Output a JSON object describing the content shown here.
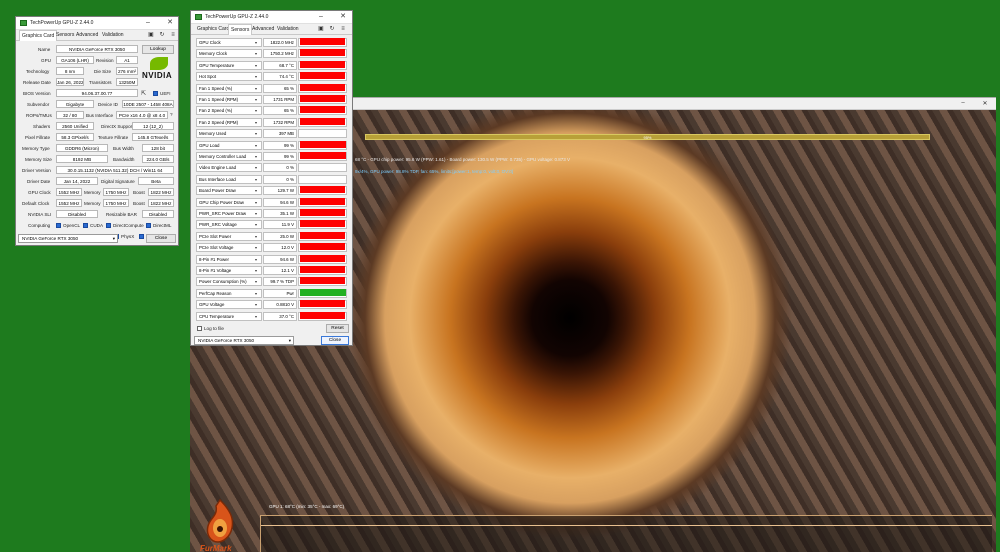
{
  "furmark": {
    "progress_label": "95%",
    "info_line1": "68 °C - GPU chip power: 95.6 W (PPW: 1.61) - Board power: 130.5 W (PPW: 0.735) - GPU voltage: 0.873 V",
    "info_line2": "9x/4%, GPU power: 98.8% TDP, fan: 65%, limits:[power:1, temp:0, volt:0, OV:0]",
    "graph_label": "GPU 1: 68°C (min: 35°C - max: 69°C)",
    "logo_text": "FurMark"
  },
  "gpuz_card": {
    "title": "TechPowerUp GPU-Z 2.44.0",
    "tabs": [
      "Graphics Card",
      "Sensors",
      "Advanced",
      "Validation"
    ],
    "lookup_label": "Lookup",
    "uefi_label": "UEFI",
    "nvidia_logo_text": "NVIDIA",
    "fields": {
      "name_label": "Name",
      "name": "NVIDIA GeForce RTX 3050",
      "gpu_label": "GPU",
      "gpu": "GA106 (LHR)",
      "revision_label": "Revision",
      "revision": "A1",
      "technology_label": "Technology",
      "technology": "8 nm",
      "die_size_label": "Die Size",
      "die_size": "276 mm²",
      "release_date_label": "Release Date",
      "release_date": "Jan 26, 2022",
      "transistors_label": "Transistors",
      "transistors": "13250M",
      "bios_label": "BIOS Version",
      "bios": "94.06.37.00.77",
      "subvendor_label": "Subvendor",
      "subvendor": "Gigabyte",
      "device_id_label": "Device ID",
      "device_id": "10DE 2507 - 1458 408A",
      "rops_label": "ROPs/TMUs",
      "rops": "32 / 80",
      "bus_label": "Bus Interface",
      "bus": "PCIe x16 4.0 @ x8 4.0",
      "shaders_label": "Shaders",
      "shaders": "2560 Unified",
      "dx_label": "DirectX Support",
      "dx": "12 (12_2)",
      "pixel_label": "Pixel Fillrate",
      "pixel": "58.3 GPixel/s",
      "texture_label": "Texture Fillrate",
      "texture": "145.8 GTexel/s",
      "memtype_label": "Memory Type",
      "memtype": "GDDR6 (Micron)",
      "buswidth_label": "Bus Width",
      "buswidth": "128 bit",
      "memsize_label": "Memory Size",
      "memsize": "8192 MB",
      "bandwidth_label": "Bandwidth",
      "bandwidth": "224.0 GB/s",
      "driver_label": "Driver Version",
      "driver": "30.0.15.1132 (NVIDIA 511.32) DCH / Win11 64",
      "driver_date_label": "Driver Date",
      "driver_date": "Jan 14, 2022",
      "sig_label": "Digital Signature",
      "sig": "Beta",
      "gpuclock_label": "GPU Clock",
      "gpuclock": "1552 MHz",
      "memory_label": "Memory",
      "memory": "1750 MHz",
      "boost_label": "Boost",
      "boost": "1822 MHz",
      "defclock_label": "Default Clock",
      "defclock": "1552 MHz",
      "defmemory": "1750 MHz",
      "defboost": "1822 MHz",
      "sli_label": "NVIDIA SLI",
      "sli": "Disabled",
      "bar_label": "Resizable BAR",
      "bar": "Disabled",
      "computing_label": "Computing",
      "technologies_label": "Technologies"
    },
    "computing": [
      "OpenCL",
      "CUDA",
      "DirectCompute",
      "DirectML"
    ],
    "technologies": [
      "Vulkan",
      "Ray Tracing",
      "PhysX",
      "OpenGL 4.6"
    ],
    "gpu_select": "NVIDIA GeForce RTX 3050",
    "close_label": "Close"
  },
  "gpuz_sensors": {
    "title": "TechPowerUp GPU-Z 2.44.0",
    "tabs": [
      "Graphics Card",
      "Sensors",
      "Advanced",
      "Validation"
    ],
    "log_label": "Log to file",
    "reset_label": "Reset",
    "gpu_select": "NVIDIA GeForce RTX 3050",
    "close_label": "Close",
    "bar_color": "#ff0000",
    "perfcap_color": "#22b022",
    "sensors": [
      {
        "name": "GPU Clock",
        "value": "1822.0 MHz",
        "fill": 0.95
      },
      {
        "name": "Memory Clock",
        "value": "1750.2 MHz",
        "fill": 0.95
      },
      {
        "name": "GPU Temperature",
        "value": "68.7 °C",
        "fill": 0.95
      },
      {
        "name": "Hot Spot",
        "value": "74.4 °C",
        "fill": 0.95
      },
      {
        "name": "Fan 1 Speed (%)",
        "value": "65 %",
        "fill": 0.95
      },
      {
        "name": "Fan 1 Speed (RPM)",
        "value": "1731 RPM",
        "fill": 0.95
      },
      {
        "name": "Fan 2 Speed (%)",
        "value": "65 %",
        "fill": 0.95
      },
      {
        "name": "Fan 2 Speed (RPM)",
        "value": "1732 RPM",
        "fill": 0.95
      },
      {
        "name": "Memory Used",
        "value": "397 MB",
        "fill": 0
      },
      {
        "name": "GPU Load",
        "value": "99 %",
        "fill": 0.98
      },
      {
        "name": "Memory Controller Load",
        "value": "99 %",
        "fill": 0.98
      },
      {
        "name": "Video Engine Load",
        "value": "0 %",
        "fill": 0
      },
      {
        "name": "Bus Interface Load",
        "value": "0 %",
        "fill": 0
      },
      {
        "name": "Board Power Draw",
        "value": "129.7 W",
        "fill": 0.95
      },
      {
        "name": "GPU Chip Power Draw",
        "value": "94.6 W",
        "fill": 0.95
      },
      {
        "name": "PWR_SRC Power Draw",
        "value": "35.1 W",
        "fill": 0.95
      },
      {
        "name": "PWR_SRC Voltage",
        "value": "11.9 V",
        "fill": 0.95
      },
      {
        "name": "PCIe Slot Power",
        "value": "25.0 W",
        "fill": 0.95
      },
      {
        "name": "PCIe Slot Voltage",
        "value": "12.0 V",
        "fill": 0.95
      },
      {
        "name": "8-Pin #1 Power",
        "value": "94.6 W",
        "fill": 0.95
      },
      {
        "name": "8-Pin #1 Voltage",
        "value": "12.1 V",
        "fill": 0.95
      },
      {
        "name": "Power Consumption (%)",
        "value": "99.7 % TDP",
        "fill": 0.95
      },
      {
        "name": "PerfCap Reason",
        "value": "Pwr",
        "fill": 0.98,
        "green": true
      },
      {
        "name": "GPU Voltage",
        "value": "0.8810 V",
        "fill": 0.95
      },
      {
        "name": "CPU Temperature",
        "value": "37.0 °C",
        "fill": 0.95
      }
    ]
  }
}
